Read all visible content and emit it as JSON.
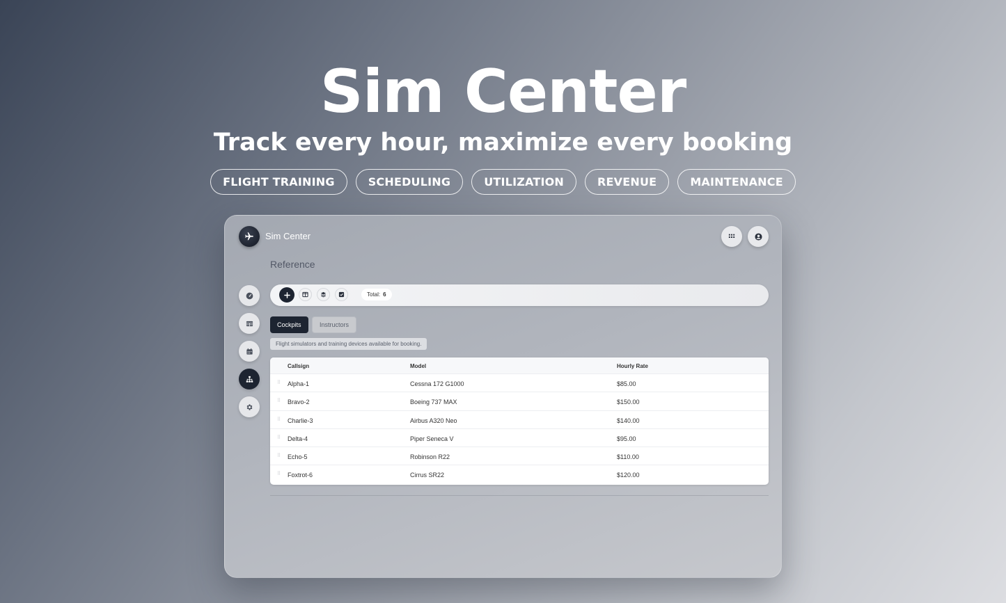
{
  "hero": {
    "title": "Sim Center",
    "subtitle": "Track every hour, maximize every booking",
    "tags": [
      "FLIGHT TRAINING",
      "SCHEDULING",
      "UTILIZATION",
      "REVENUE",
      "MAINTENANCE"
    ]
  },
  "app": {
    "name": "Sim Center",
    "logo_icon": "airplane-icon",
    "top_actions": [
      "apps-grid-icon",
      "user-circle-icon"
    ]
  },
  "sidebar": {
    "items": [
      {
        "icon": "dashboard-gauge-icon",
        "active": false
      },
      {
        "icon": "table-icon",
        "active": false
      },
      {
        "icon": "calendar-icon",
        "active": false
      },
      {
        "icon": "hierarchy-icon",
        "active": true
      },
      {
        "icon": "gear-icon",
        "active": false
      }
    ]
  },
  "main": {
    "section_title": "Reference",
    "toolbar": {
      "buttons": [
        "add-icon",
        "columns-icon",
        "layers-icon",
        "checkbox-icon"
      ],
      "total_label": "Total:",
      "total_value": "6"
    },
    "tabs": [
      {
        "label": "Cockpits",
        "active": true
      },
      {
        "label": "Instructors",
        "active": false
      }
    ],
    "description": "Flight simulators and training devices available for booking.",
    "table": {
      "columns": [
        "Callsign",
        "Model",
        "Hourly Rate"
      ],
      "rows": [
        [
          "Alpha-1",
          "Cessna 172 G1000",
          "$85.00"
        ],
        [
          "Bravo-2",
          "Boeing 737 MAX",
          "$150.00"
        ],
        [
          "Charlie-3",
          "Airbus A320 Neo",
          "$140.00"
        ],
        [
          "Delta-4",
          "Piper Seneca V",
          "$95.00"
        ],
        [
          "Echo-5",
          "Robinson R22",
          "$110.00"
        ],
        [
          "Foxtrot-6",
          "Cirrus SR22",
          "$120.00"
        ]
      ]
    }
  },
  "colors": {
    "primary_dark": "#1d2431",
    "text_white": "#ffffff"
  }
}
